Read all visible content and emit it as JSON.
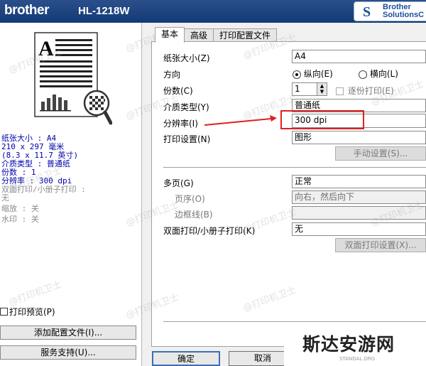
{
  "header": {
    "brand": "brother",
    "model": "HL-1218W",
    "solutions_line1": "Brother",
    "solutions_line2": "SolutionsC"
  },
  "summary": {
    "lines": [
      "纸张大小 : A4",
      "210 x 297 毫米",
      "(8.3 x 11.7 英寸)",
      "介质类型 : 普通纸",
      "份数 : 1",
      "分辨率 : 300 dpi"
    ],
    "gray_lines": [
      "双面打印/小册子打印 :",
      "无",
      "缩放 : 关",
      "水印 : 关"
    ]
  },
  "left": {
    "print_preview_label": "打印预览(P)",
    "add_profile_button": "添加配置文件(I)...",
    "support_button": "服务支持(U)..."
  },
  "tabs": [
    "基本",
    "高级",
    "打印配置文件"
  ],
  "form": {
    "paper_size_label": "纸张大小(Z)",
    "paper_size_value": "A4",
    "orientation_label": "方向",
    "portrait_label": "纵向(E)",
    "landscape_label": "横向(L)",
    "copies_label": "份数(C)",
    "copies_value": "1",
    "collate_label": "逐份打印(E)",
    "media_label": "介质类型(Y)",
    "media_value": "普通纸",
    "resolution_label": "分辨率(I)",
    "resolution_value": "300 dpi",
    "print_setting_label": "打印设置(N)",
    "print_setting_value": "图形",
    "manual_setting_button": "手动设置(S)...",
    "multipage_label": "多页(G)",
    "multipage_value": "正常",
    "page_order_label": "页序(O)",
    "page_order_value": "向右，然后向下",
    "border_label": "边框线(B)",
    "border_value": "",
    "duplex_label": "双面打印/小册子打印(K)",
    "duplex_value": "无",
    "duplex_setting_button": "双面打印设置(X)..."
  },
  "buttons": {
    "ok": "确定",
    "cancel": "取消"
  },
  "overlay": {
    "logo_text": "斯达安游网",
    "logo_subtext": "STANDAL.ORG",
    "watermark": "@打印机卫士"
  },
  "colors": {
    "header": "#1f4584",
    "arrow": "#e02020",
    "highlight_box": "#e02020",
    "summary_text": "#0000aa"
  }
}
